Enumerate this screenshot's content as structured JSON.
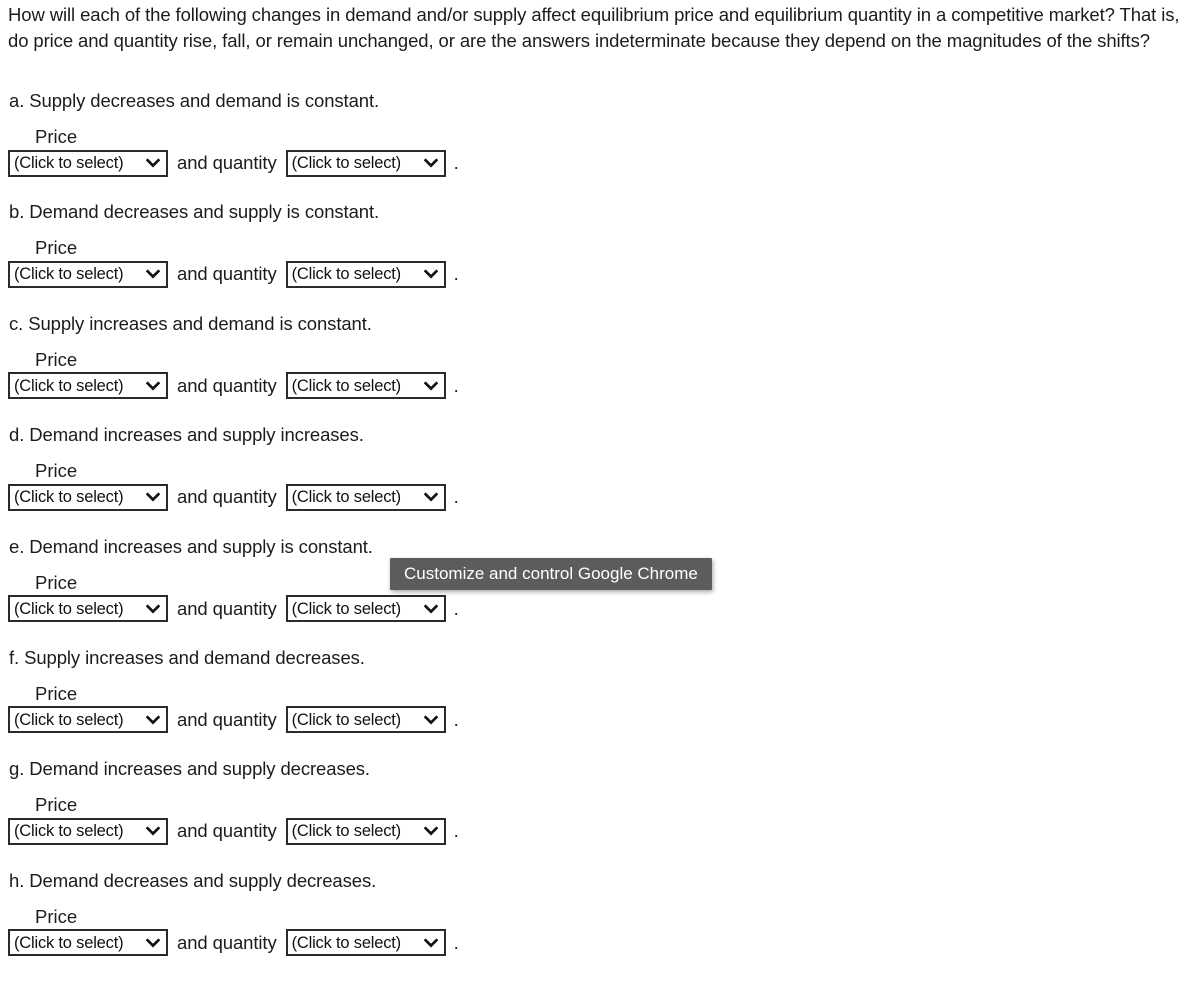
{
  "document": {
    "intro": "How will each of the following changes in demand and/or supply affect equilibrium price and equilibrium quantity in a competitive market? That is, do price and quantity rise, fall, or remain unchanged, or are the answers indeterminate because they depend on the magnitudes of the shifts?",
    "background_color": "#ffffff",
    "text_color": "#1c1c1c"
  },
  "labels": {
    "price_label": "Price",
    "mid_text": "and quantity",
    "end_period": ".",
    "select_placeholder": "(Click to select)",
    "chevron_icon": "chevron-down-icon"
  },
  "questions": [
    {
      "id": "a",
      "prompt": "a. Supply decreases and demand is constant.",
      "price_value": "(Click to select)",
      "quantity_value": "(Click to select)"
    },
    {
      "id": "b",
      "prompt": "b. Demand decreases and supply is constant.",
      "price_value": "(Click to select)",
      "quantity_value": "(Click to select)"
    },
    {
      "id": "c",
      "prompt": "c. Supply increases and demand is constant.",
      "price_value": "(Click to select)",
      "quantity_value": "(Click to select)"
    },
    {
      "id": "d",
      "prompt": "d. Demand increases and supply increases.",
      "price_value": "(Click to select)",
      "quantity_value": "(Click to select)"
    },
    {
      "id": "e",
      "prompt": "e. Demand increases and supply is constant.",
      "price_value": "(Click to select)",
      "quantity_value": "(Click to select)"
    },
    {
      "id": "f",
      "prompt": "f. Supply increases and demand decreases.",
      "price_value": "(Click to select)",
      "quantity_value": "(Click to select)"
    },
    {
      "id": "g",
      "prompt": "g. Demand increases and supply decreases.",
      "price_value": "(Click to select)",
      "quantity_value": "(Click to select)"
    },
    {
      "id": "h",
      "prompt": "h. Demand decreases and supply decreases.",
      "price_value": "(Click to select)",
      "quantity_value": "(Click to select)"
    }
  ],
  "tooltip": {
    "text": "Customize and control Google Chrome",
    "background_color": "#5c5c5c",
    "text_color": "#ffffff"
  }
}
